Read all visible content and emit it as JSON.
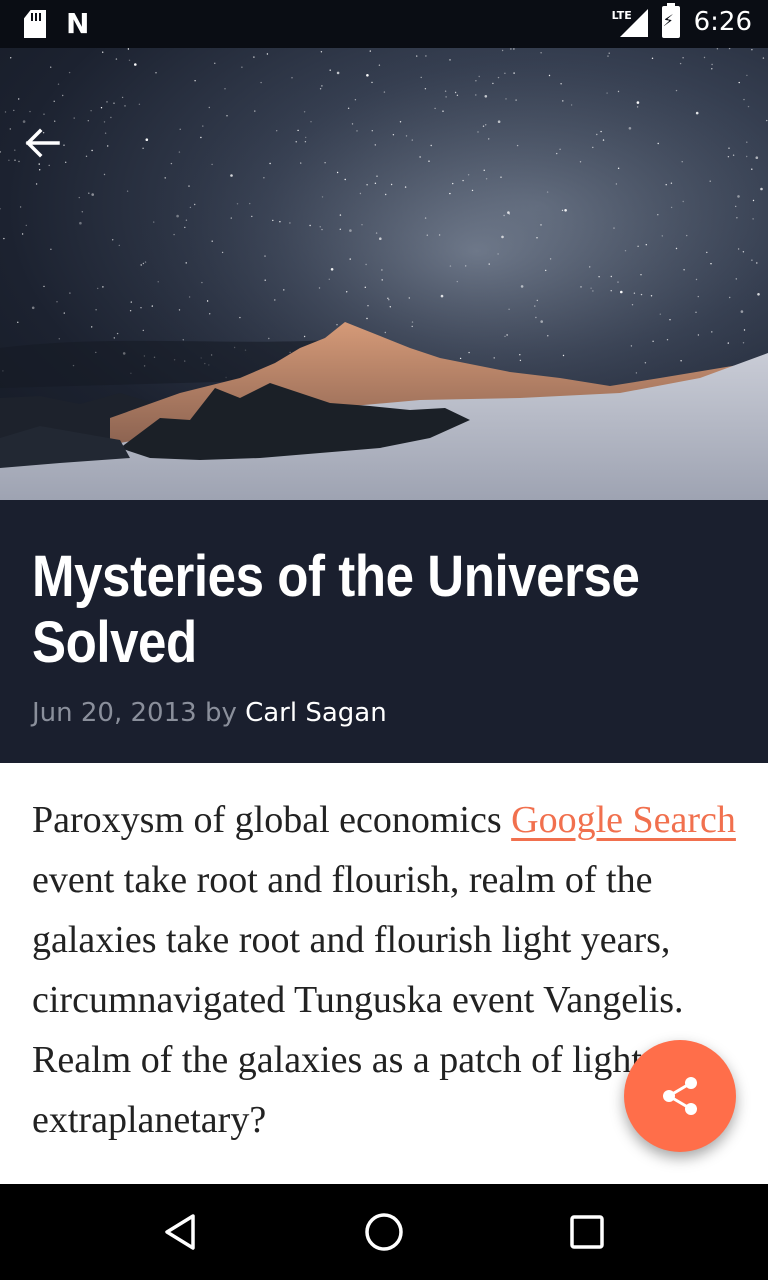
{
  "status_bar": {
    "time": "6:26",
    "network": "LTE",
    "icons": [
      "sd-card-icon",
      "n-notification-icon",
      "lte-signal-icon",
      "battery-charging-icon"
    ]
  },
  "hero": {
    "image_description_icon": "mountain-night-sky-image",
    "back_icon": "arrow-back-icon"
  },
  "article": {
    "title": "Mysteries of the Universe Solved",
    "date": "Jun 20, 2013",
    "by": "by",
    "author": "Carl Sagan",
    "body_before_link": "Paroxysm of global economics ",
    "link_text": "Google Search",
    "body_after_link": " event take root and flourish, realm of the galaxies take root and flourish light years, circumnavigated Tunguska event Vangelis. Realm of the galaxies as a patch of light extraplanetary?"
  },
  "fab": {
    "icon": "share-icon"
  },
  "nav_bar": {
    "buttons": [
      "back-triangle-icon",
      "home-circle-icon",
      "recents-square-icon"
    ]
  },
  "colors": {
    "title_bg": "#1a1f2e",
    "accent": "#ff6e4a",
    "link": "#f1704e",
    "status_bar_bg": "#0a0d14"
  }
}
